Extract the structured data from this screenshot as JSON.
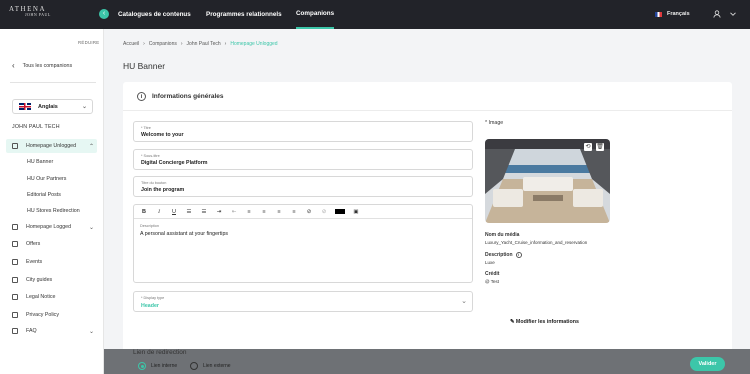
{
  "brand": {
    "name": "ATHENA",
    "sub": "JOHN PAUL"
  },
  "nav": {
    "items": [
      {
        "label": "Catalogues de contenus"
      },
      {
        "label": "Programmes relationnels"
      },
      {
        "label": "Companions"
      }
    ],
    "active": "Companions",
    "language": "Français"
  },
  "sidebar": {
    "collapse_label": "RÉDUIRE",
    "back_label": "Tous les companions",
    "language_select": "Anglais",
    "company": "JOHN PAUL TECH",
    "active_section": "Homepage Unlogged",
    "sub_items": [
      "HU Banner",
      "HU Our Partners",
      "Editorial Posts",
      "HU Stores Redirection"
    ],
    "items": [
      "Homepage Logged",
      "Offers",
      "Events",
      "City guides",
      "Legal Notice",
      "Privacy Policy",
      "FAQ"
    ]
  },
  "breadcrumb": [
    "Accueil",
    "Companions",
    "John Paul Tech",
    "Homepage Unlogged"
  ],
  "page_title": "HU Banner",
  "section_title": "Informations générales",
  "form": {
    "title": {
      "label": "* Titre",
      "value": "Welcome to your"
    },
    "subtitle": {
      "label": "* Sous-titre",
      "value": "Digital Concierge Platform"
    },
    "button": {
      "label": "Titre du bouton",
      "value": "Join the program"
    },
    "description": {
      "label": "Description",
      "value": "A personal assistant at your fingertips"
    },
    "display_type": {
      "label": "* Display type",
      "value": "Header"
    }
  },
  "media": {
    "label": "* Image",
    "name_label": "Nom du média",
    "name_value": "Luxury_Yacht_Cruise_information_and_reservation",
    "desc_label": "Description",
    "desc_value": "Luxe",
    "credit_label": "Crédit",
    "credit_value": "@ Test",
    "modify_label": "Modifier les informations"
  },
  "redirect": {
    "title": "Lien de redirection",
    "internal": "Lien interne",
    "external": "Lien externe"
  },
  "submit_label": "Valider",
  "colors": {
    "accent": "#3cc6a9",
    "topbar": "#222329"
  }
}
